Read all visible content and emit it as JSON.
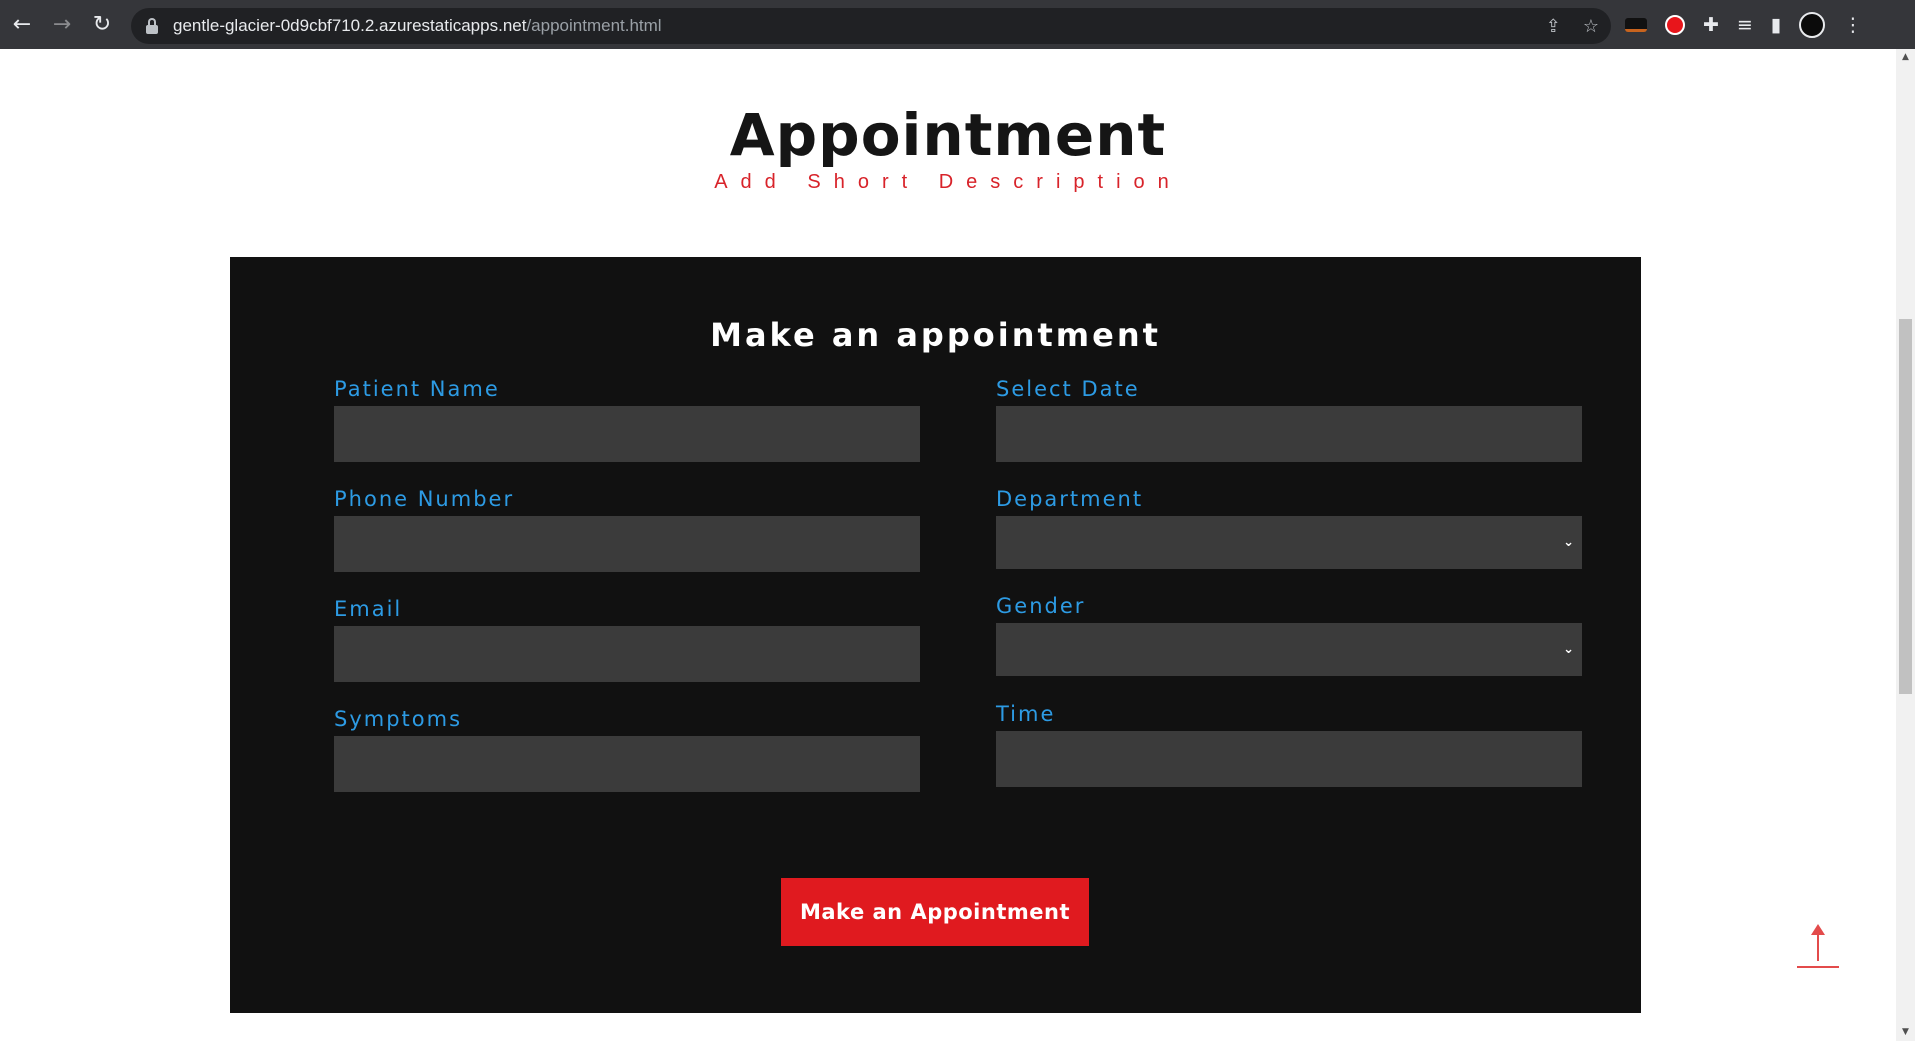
{
  "browser": {
    "url_host": "gentle-glacier-0d9cbf710.2.azurestaticapps.net",
    "url_path": "/appointment.html",
    "back_glyph": "←",
    "forward_glyph": "→",
    "reload_glyph": "↻",
    "share_glyph": "⇪",
    "star_glyph": "☆",
    "extensions_glyph": "✚",
    "media_glyph": "≡",
    "sidepanel_glyph": "▮",
    "menu_glyph": "⋮",
    "accent_red": "#e8151b"
  },
  "header": {
    "title": "Appointment",
    "subtitle": "Add Short Description"
  },
  "form": {
    "heading": "Make an appointment",
    "label_color": "#2d9be4",
    "left_fields": [
      {
        "label": "Patient Name",
        "value": ""
      },
      {
        "label": "Phone Number",
        "value": ""
      },
      {
        "label": "Email",
        "value": ""
      },
      {
        "label": "Symptoms",
        "value": ""
      }
    ],
    "right_fields": [
      {
        "label": "Select Date",
        "value": ""
      },
      {
        "label": "Department",
        "value": ""
      },
      {
        "label": "Gender",
        "value": ""
      },
      {
        "label": "Time",
        "value": ""
      }
    ],
    "submit_label": "Make an Appointment",
    "submit_color": "#e01a1f"
  },
  "scrollbar": {
    "up_glyph": "▲",
    "down_glyph": "▼"
  }
}
